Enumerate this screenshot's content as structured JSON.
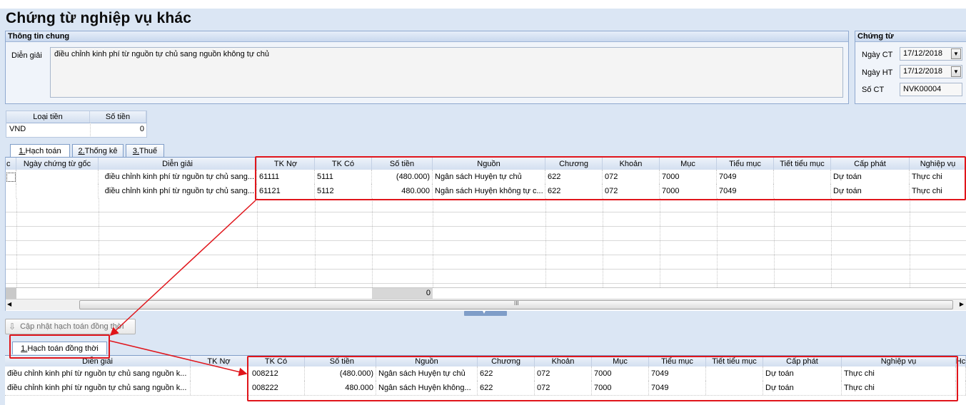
{
  "window": {
    "title": "Chứng từ nghiệp vụ khác"
  },
  "general": {
    "header": "Thông tin chung",
    "desc_label": "Diễn giải",
    "desc_value": "điều chỉnh kinh phí từ nguồn tự chủ sang nguồn không tự chủ"
  },
  "voucher": {
    "header": "Chứng từ",
    "date_ct_label": "Ngày CT",
    "date_ct_value": "17/12/2018",
    "date_ht_label": "Ngày HT",
    "date_ht_value": "17/12/2018",
    "so_ct_label": "Số CT",
    "so_ct_value": "NVK00004"
  },
  "currency": {
    "col_type": "Loại tiền",
    "col_amount": "Số tiền",
    "type_value": "VND",
    "amount_value": "0"
  },
  "tabs": [
    {
      "num": "1.",
      "label": " Hạch toán"
    },
    {
      "num": "2.",
      "label": " Thống kê"
    },
    {
      "num": "3.",
      "label": " Thuế"
    }
  ],
  "main_grid": {
    "columns": [
      "c",
      "Ngày chứng từ gốc",
      "Diễn giải",
      "TK Nợ",
      "TK Có",
      "Số tiền",
      "Nguồn",
      "Chương",
      "Khoản",
      "Mục",
      "Tiểu mục",
      "Tiết tiểu mục",
      "Cấp phát",
      "Nghiệp vụ"
    ],
    "rows": [
      [
        "",
        "",
        "điều chỉnh kinh phí từ nguồn tự chủ sang...",
        "61111",
        "5111",
        "(480.000)",
        "Ngân sách Huyện tự chủ",
        "622",
        "072",
        "7000",
        "7049",
        "",
        "Dự toán",
        "Thực chi"
      ],
      [
        "",
        "",
        "điều chỉnh kinh phí từ nguồn tự chủ sang...",
        "61121",
        "5112",
        "480.000",
        "Ngân sách Huyện không tự c...",
        "622",
        "072",
        "7000",
        "7049",
        "",
        "Dự toán",
        "Thực chi"
      ]
    ],
    "total": "0",
    "scroll_mark": "III"
  },
  "update_button": "Cập nhật hạch toán đồng thời",
  "bottom_tab": {
    "num": "1.",
    "label": " Hạch toán đồng thời"
  },
  "bottom_grid": {
    "columns": [
      "Diễn giải",
      "TK Nợ",
      "TK Có",
      "Số tiền",
      "Nguồn",
      "Chương",
      "Khoản",
      "Mục",
      "Tiểu mục",
      "Tiết tiểu mục",
      "Cấp phát",
      "Nghiệp vụ",
      "Hc"
    ],
    "rows": [
      [
        "điều chỉnh kinh phí từ nguồn tự chủ sang nguồn k...",
        "",
        "008212",
        "(480.000)",
        "Ngân sách Huyện tự chủ",
        "622",
        "072",
        "7000",
        "7049",
        "",
        "Dự toán",
        "Thực chi",
        ""
      ],
      [
        "điều chỉnh kinh phí từ nguồn tự chủ sang nguồn k...",
        "",
        "008222",
        "480.000",
        "Ngân sách Huyện không...",
        "622",
        "072",
        "7000",
        "7049",
        "",
        "Dự toán",
        "Thực chi",
        ""
      ]
    ]
  },
  "colors": {
    "highlight": "#e0151b",
    "panel_border": "#8fa9cf",
    "background": "#dbe6f4"
  }
}
